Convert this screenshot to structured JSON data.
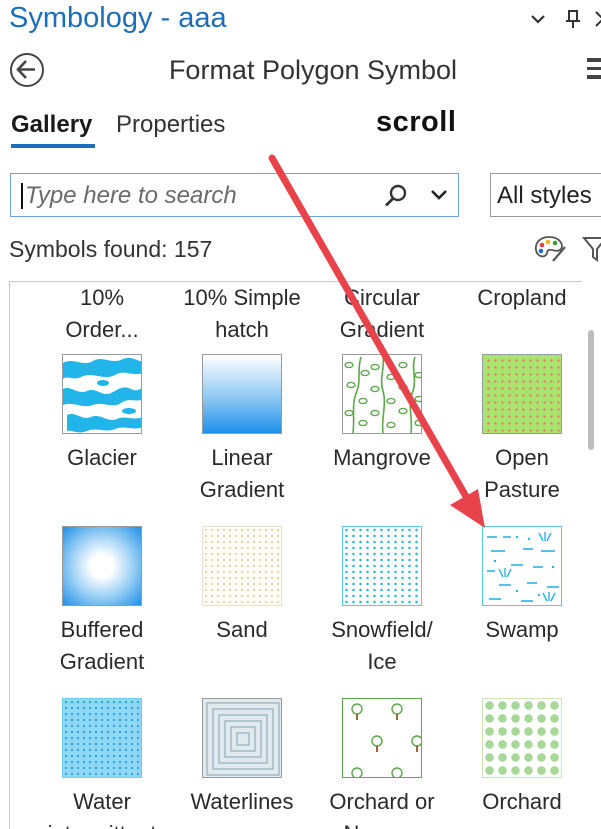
{
  "window": {
    "title": "Symbology - aaa",
    "pane_title": "Format Polygon Symbol"
  },
  "tabs": [
    {
      "label": "Gallery",
      "active": true
    },
    {
      "label": "Properties",
      "active": false
    }
  ],
  "annotation": {
    "text": "scroll",
    "arrow_color": "#e8434b"
  },
  "search": {
    "placeholder": "Type here to search",
    "value": ""
  },
  "style_filter": {
    "selected": "All styles"
  },
  "results": {
    "found_text": "Symbols found: 157"
  },
  "icons": {
    "back": "back-arrow-icon",
    "menu": "hamburger-menu-icon",
    "search": "search-icon",
    "palette": "palette-icon",
    "filter": "filter-icon"
  },
  "colors": {
    "accent": "#1b6fba",
    "search_border": "#6aa6da"
  },
  "gallery": {
    "partial_row_labels": [
      [
        "10%",
        "Order..."
      ],
      [
        "10% Simple",
        "hatch"
      ],
      [
        "Circular",
        "Gradient"
      ],
      [
        "Cropland",
        ""
      ]
    ],
    "rows": [
      [
        {
          "label1": "Glacier",
          "label2": "",
          "pattern": "glacier"
        },
        {
          "label1": "Linear",
          "label2": "Gradient",
          "pattern": "linear-gradient"
        },
        {
          "label1": "Mangrove",
          "label2": "",
          "pattern": "mangrove"
        },
        {
          "label1": "Open",
          "label2": "Pasture",
          "pattern": "open-pasture"
        }
      ],
      [
        {
          "label1": "Buffered",
          "label2": "Gradient",
          "pattern": "buffered-gradient"
        },
        {
          "label1": "Sand",
          "label2": "",
          "pattern": "sand"
        },
        {
          "label1": "Snowfield/",
          "label2": "Ice",
          "pattern": "snowfield"
        },
        {
          "label1": "Swamp",
          "label2": "",
          "pattern": "swamp"
        }
      ],
      [
        {
          "label1": "Water",
          "label2": "intermittent",
          "pattern": "water"
        },
        {
          "label1": "Waterlines",
          "label2": "",
          "pattern": "waterlines"
        },
        {
          "label1": "Orchard or",
          "label2": "Nursery",
          "pattern": "orchard-nursery"
        },
        {
          "label1": "Orchard",
          "label2": "",
          "pattern": "orchard"
        }
      ]
    ]
  }
}
